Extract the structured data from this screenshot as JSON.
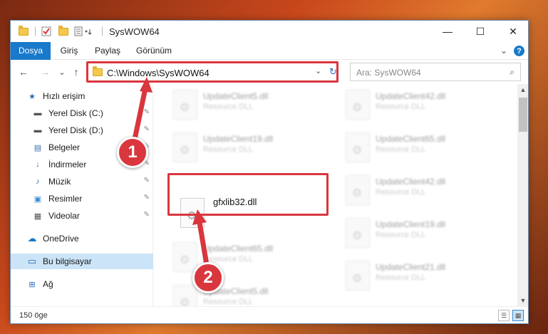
{
  "window": {
    "title": "SysWOW64",
    "minimize_glyph": "—",
    "maximize_glyph": "☐",
    "close_glyph": "✕"
  },
  "ribbon": {
    "tabs": [
      {
        "label": "Dosya"
      },
      {
        "label": "Giriş"
      },
      {
        "label": "Paylaş"
      },
      {
        "label": "Görünüm"
      }
    ],
    "expand_glyph": "⌄",
    "help_glyph": "?"
  },
  "nav": {
    "back": "←",
    "forward": "→",
    "recent": "⌄",
    "up": "↑"
  },
  "address": {
    "path": "C:\\Windows\\SysWOW64",
    "dropdown": "⌄",
    "refresh": "↻"
  },
  "search": {
    "placeholder": "Ara: SysWOW64",
    "icon": "⌕"
  },
  "sidebar": {
    "items": [
      {
        "label": "Hızlı erişim",
        "icon": "★"
      },
      {
        "label": "Yerel Disk (C:)",
        "icon": "▬"
      },
      {
        "label": "Yerel Disk (D:)",
        "icon": "▬"
      },
      {
        "label": "Belgeler",
        "icon": "▤"
      },
      {
        "label": "İndirmeler",
        "icon": "↓"
      },
      {
        "label": "Müzik",
        "icon": "♪"
      },
      {
        "label": "Resimler",
        "icon": "▣"
      },
      {
        "label": "Videolar",
        "icon": "▦"
      },
      {
        "label": "OneDrive",
        "icon": "☁"
      },
      {
        "label": "Bu bilgisayar",
        "icon": "▭"
      },
      {
        "label": "Ağ",
        "icon": "⊞"
      }
    ],
    "pin_glyph": "✎"
  },
  "files": {
    "left": [
      {
        "name": "UpdateClient5.dll",
        "desc": "Resource DLL"
      },
      {
        "name": "UpdateClient19.dll",
        "desc": "Resource DLL"
      },
      {
        "name": "gfxlib32.dll",
        "desc": ""
      },
      {
        "name": "UpdateClient65.dll",
        "desc": "Resource DLL"
      },
      {
        "name": "UpdateClient5.dll",
        "desc": "Resource DLL"
      }
    ],
    "right": [
      {
        "name": "UpdateClient42.dll",
        "desc": "Resource DLL"
      },
      {
        "name": "UpdateClient65.dll",
        "desc": "Resource DLL"
      },
      {
        "name": "UpdateClient42.dll",
        "desc": "Resource DLL"
      },
      {
        "name": "UpdateClient19.dll",
        "desc": "Resource DLL"
      },
      {
        "name": "UpdateClient21.dll",
        "desc": "Resource DLL"
      }
    ]
  },
  "status": {
    "count": "150 öge"
  },
  "callouts": {
    "step1": "1",
    "step2": "2"
  },
  "colors": {
    "accent": "#1979ca",
    "highlight": "#d9363e",
    "selection": "#cce4f7"
  }
}
